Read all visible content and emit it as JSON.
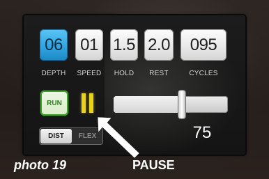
{
  "params": [
    {
      "key": "depth",
      "value": "06",
      "label": "DEPTH",
      "selected": true
    },
    {
      "key": "speed",
      "value": "01",
      "label": "SPEED",
      "selected": false
    },
    {
      "key": "hold",
      "value": "1.5",
      "label": "HOLD",
      "selected": false
    },
    {
      "key": "rest",
      "value": "2.0",
      "label": "REST",
      "selected": false
    },
    {
      "key": "cycles",
      "value": "095",
      "label": "CYCLES",
      "selected": false
    }
  ],
  "controls": {
    "run_label": "RUN",
    "slider_value": "75",
    "slider_fraction": 0.6
  },
  "mode": {
    "dist": "DIST",
    "flex": "FLEX",
    "active": "dist"
  },
  "captions": {
    "photo": "photo 19",
    "pause": "PAUSE"
  },
  "colors": {
    "selected_param": "#31a6e2",
    "run_border": "#3ea12b",
    "pause_icon": "#e9d21a"
  },
  "icons": {
    "pause": "pause-icon",
    "arrow": "arrow-icon"
  }
}
